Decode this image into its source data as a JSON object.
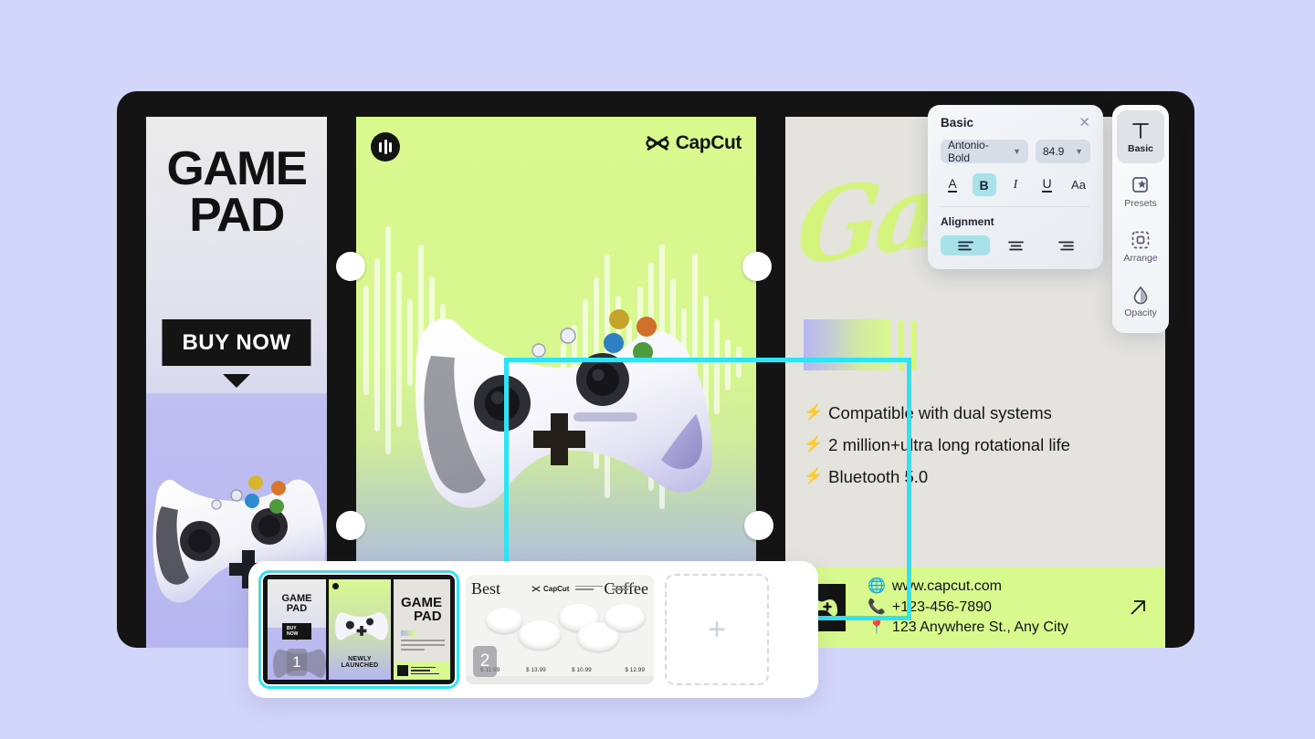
{
  "app": {
    "background_color": "#d3d6fb",
    "frame_color": "#141414",
    "accent_green": "#d8f98e",
    "accent_cyan": "#2fe3f5",
    "accent_lavender": "#b6b5ef"
  },
  "poster": {
    "panel1": {
      "title_line1": "GAME",
      "title_line2": "PAD",
      "cta_label": "BUY NOW",
      "caret_icon": "caret-down-icon",
      "product_image": "white-gamepad"
    },
    "panel2": {
      "audio_icon": "audio-waveform-icon",
      "brand": "CapCut",
      "brand_icon": "capcut-logo-icon",
      "product_image": "white-gamepad-large"
    },
    "panel3": {
      "script_text": "Game",
      "features": [
        {
          "icon": "bolt-icon",
          "text": "Compatible with dual systems"
        },
        {
          "icon": "bolt-icon",
          "text": "2 million+ultra long rotational life"
        },
        {
          "icon": "bolt-icon",
          "text": "Bluetooth 5.0"
        }
      ],
      "footer": {
        "mark_icon": "gamepad-mark-icon",
        "contacts": [
          {
            "icon": "globe-icon",
            "text": "www.capcut.com"
          },
          {
            "icon": "phone-icon",
            "text": "+123-456-7890"
          },
          {
            "icon": "location-pin-icon",
            "text": "123 Anywhere St., Any City"
          }
        ],
        "arrow_icon": "arrow-up-right-icon"
      }
    }
  },
  "text_panel": {
    "title": "Basic",
    "close_icon": "close-icon",
    "font_family_value": "Antonio-Bold",
    "font_size_value": "84.9",
    "format_buttons": [
      {
        "name": "text-color-button",
        "label": "A",
        "active": false
      },
      {
        "name": "bold-button",
        "label": "B",
        "active": true
      },
      {
        "name": "italic-button",
        "label": "I",
        "active": false
      },
      {
        "name": "underline-button",
        "label": "U",
        "active": false
      },
      {
        "name": "case-button",
        "label": "Aa",
        "active": false
      }
    ],
    "alignment_label": "Alignment",
    "alignment_options": [
      {
        "name": "align-left-button",
        "active": true
      },
      {
        "name": "align-center-button",
        "active": false
      },
      {
        "name": "align-right-button",
        "active": false
      }
    ]
  },
  "tool_rail": [
    {
      "icon": "text-basic-icon",
      "label": "Basic",
      "active": true
    },
    {
      "icon": "presets-icon",
      "label": "Presets",
      "active": false
    },
    {
      "icon": "arrange-icon",
      "label": "Arrange",
      "active": false
    },
    {
      "icon": "opacity-icon",
      "label": "Opacity",
      "active": false
    }
  ],
  "filmstrip": {
    "pages": [
      {
        "number": "1",
        "selected": true,
        "caption": "GAME PAD poster",
        "mini": {
          "title1": "GAME",
          "title2": "PAD",
          "cta": "BUY NOW",
          "ribbon": "NEWLY LAUNCHED",
          "headline1": "GAME",
          "headline2": "PAD"
        }
      },
      {
        "number": "2",
        "selected": false,
        "caption": "Best Coffee poster",
        "mini": {
          "word_left": "Best",
          "word_right": "Coffee",
          "brand": "CapCut",
          "prices": [
            "$ 11.99",
            "$ 13.99",
            "$ 10.99",
            "$ 12.99"
          ]
        }
      }
    ],
    "add_label": "+",
    "add_icon": "plus-icon"
  }
}
